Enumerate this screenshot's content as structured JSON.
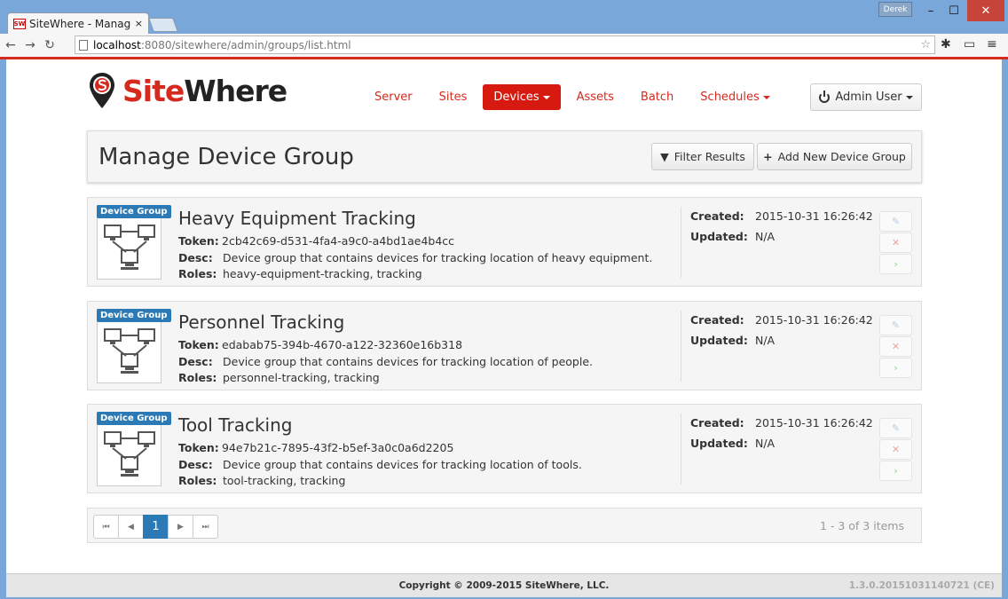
{
  "browser": {
    "tab_title": "SiteWhere - Manage",
    "tab_close": "×",
    "user_badge": "Derek",
    "url_host": "localhost",
    "url_path": ":8080/sitewhere/admin/groups/list.html",
    "window_minimize": "–",
    "window_maximize": "☐",
    "window_close": "✕"
  },
  "logo": {
    "part_a": "Site",
    "part_b": "Where"
  },
  "nav": [
    {
      "label": "Server",
      "active": false
    },
    {
      "label": "Sites",
      "active": false
    },
    {
      "label": "Devices",
      "active": true,
      "dropdown": true
    },
    {
      "label": "Assets",
      "active": false
    },
    {
      "label": "Batch",
      "active": false
    },
    {
      "label": "Schedules",
      "active": false,
      "dropdown": true
    }
  ],
  "user_menu": {
    "label": "Admin User"
  },
  "page": {
    "title": "Manage Device Group",
    "filter_label": "Filter Results",
    "add_label": "Add New Device Group"
  },
  "labels": {
    "token": "Token:",
    "desc": "Desc:",
    "roles": "Roles:",
    "created": "Created:",
    "updated": "Updated:",
    "badge": "Device Group"
  },
  "groups": [
    {
      "name": "Heavy Equipment Tracking",
      "token": "2cb42c69-d531-4fa4-a9c0-a4bd1ae4b4cc",
      "desc": "Device group that contains devices for tracking location of heavy equipment.",
      "roles": "heavy-equipment-tracking, tracking",
      "created": "2015-10-31 16:26:42",
      "updated": "N/A"
    },
    {
      "name": "Personnel Tracking",
      "token": "edabab75-394b-4670-a122-32360e16b318",
      "desc": "Device group that contains devices for tracking location of people.",
      "roles": "personnel-tracking, tracking",
      "created": "2015-10-31 16:26:42",
      "updated": "N/A"
    },
    {
      "name": "Tool Tracking",
      "token": "94e7b21c-7895-43f2-b5ef-3a0c0a6d2205",
      "desc": "Device group that contains devices for tracking location of tools.",
      "roles": "tool-tracking, tracking",
      "created": "2015-10-31 16:26:42",
      "updated": "N/A"
    }
  ],
  "pager": {
    "first": "⏮",
    "prev": "◀",
    "current": "1",
    "next": "▶",
    "last": "⏭",
    "info": "1 - 3 of 3 items"
  },
  "footer": {
    "copyright": "Copyright © 2009-2015 SiteWhere, LLC.",
    "version": "1.3.0.20151031140721 (CE)"
  },
  "colors": {
    "brand_red": "#d62a1f",
    "accent_blue": "#2c7ab5"
  }
}
